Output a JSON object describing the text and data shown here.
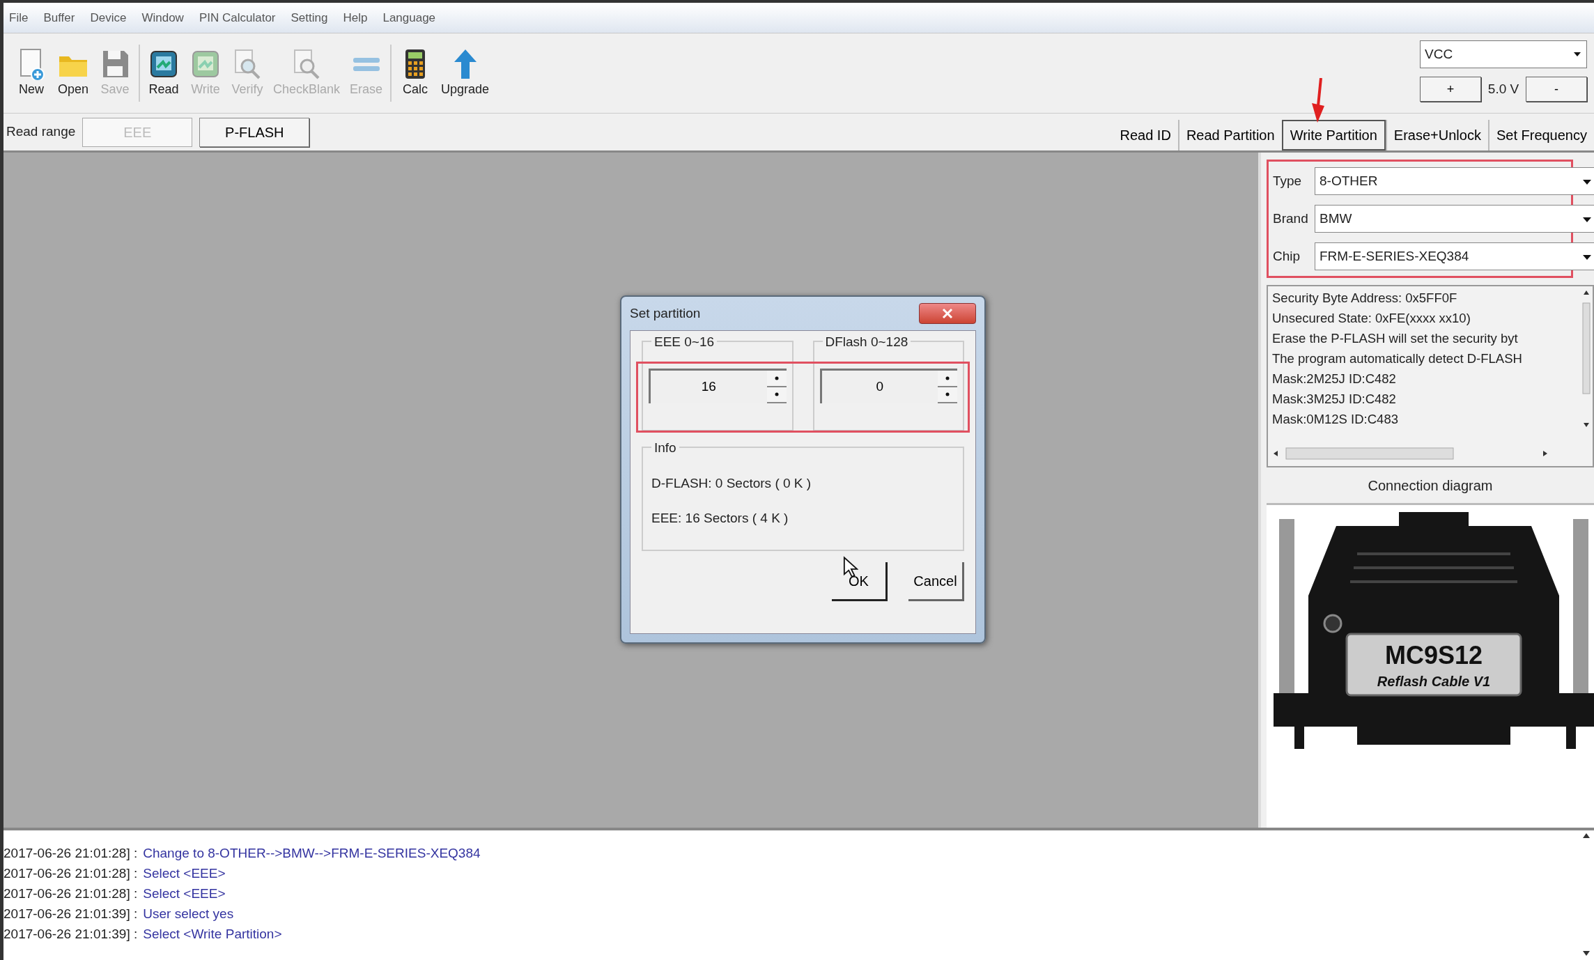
{
  "menu": [
    "File",
    "Buffer",
    "Device",
    "Window",
    "PIN Calculator",
    "Setting",
    "Help",
    "Language"
  ],
  "toolbar": [
    {
      "label": "New",
      "kind": "new",
      "disabled": false
    },
    {
      "label": "Open",
      "kind": "open",
      "disabled": false
    },
    {
      "label": "Save",
      "kind": "save",
      "disabled": true,
      "separator_after": true
    },
    {
      "label": "Read",
      "kind": "read",
      "disabled": false
    },
    {
      "label": "Write",
      "kind": "write",
      "disabled": true
    },
    {
      "label": "Verify",
      "kind": "verify",
      "disabled": true
    },
    {
      "label": "CheckBlank",
      "kind": "checkblank",
      "disabled": true
    },
    {
      "label": "Erase",
      "kind": "erase",
      "disabled": true,
      "separator_after": true
    },
    {
      "label": "Calc",
      "kind": "calc",
      "disabled": false
    },
    {
      "label": "Upgrade",
      "kind": "upgrade",
      "disabled": false
    }
  ],
  "voltage": {
    "source": "VCC",
    "plus": "+",
    "value": "5.0 V",
    "minus": "-"
  },
  "read_range": {
    "label": "Read range",
    "options": [
      {
        "label": "EEE",
        "disabled": true
      },
      {
        "label": "P-FLASH",
        "disabled": false
      }
    ]
  },
  "actions": [
    {
      "label": "Read ID",
      "selected": false,
      "arrow": false
    },
    {
      "label": "Read Partition",
      "selected": false,
      "arrow": false
    },
    {
      "label": "Write Partition",
      "selected": true,
      "arrow": true
    },
    {
      "label": "Erase+Unlock",
      "selected": false,
      "arrow": false
    },
    {
      "label": "Set Frequency",
      "selected": false,
      "arrow": false
    }
  ],
  "chip_selector": {
    "highlighted": true,
    "fields": [
      {
        "label": "Type",
        "value": "8-OTHER"
      },
      {
        "label": "Brand",
        "value": "BMW"
      },
      {
        "label": "Chip",
        "value": "FRM-E-SERIES-XEQ384"
      }
    ]
  },
  "info_text": [
    "Security Byte Address: 0x5FF0F",
    "Unsecured State: 0xFE(xxxx xx10)",
    "Erase the P-FLASH will set the security byt",
    "The program automatically detect D-FLASH",
    "Mask:2M25J ID:C482",
    "Mask:3M25J ID:C482",
    "Mask:0M12S ID:C483"
  ],
  "connection_diagram": "Connection diagram",
  "cable": {
    "title": "MC9S12",
    "subtitle": "Reflash Cable V1"
  },
  "dialog": {
    "title": "Set partition",
    "highlighted": true,
    "spinners": [
      {
        "label": "EEE 0~16",
        "value": "16"
      },
      {
        "label": "DFlash 0~128",
        "value": "0"
      }
    ],
    "info_label": "Info",
    "info_lines": [
      "D-FLASH: 0 Sectors ( 0 K )",
      "EEE: 16 Sectors ( 4 K )"
    ],
    "buttons": [
      {
        "label": "OK",
        "kind": "ok"
      },
      {
        "label": "Cancel",
        "kind": "cancel"
      }
    ]
  },
  "log": [
    {
      "time": "2017-06-26 21:01:28] :",
      "message": "Change to 8-OTHER-->BMW-->FRM-E-SERIES-XEQ384"
    },
    {
      "time": "2017-06-26 21:01:28] :",
      "message": "Select <EEE>"
    },
    {
      "time": "2017-06-26 21:01:28] :",
      "message": "Select <EEE>"
    },
    {
      "time": "2017-06-26 21:01:39] :",
      "message": "User select yes"
    },
    {
      "time": "2017-06-26 21:01:39] :",
      "message": "Select <Write Partition>"
    }
  ]
}
